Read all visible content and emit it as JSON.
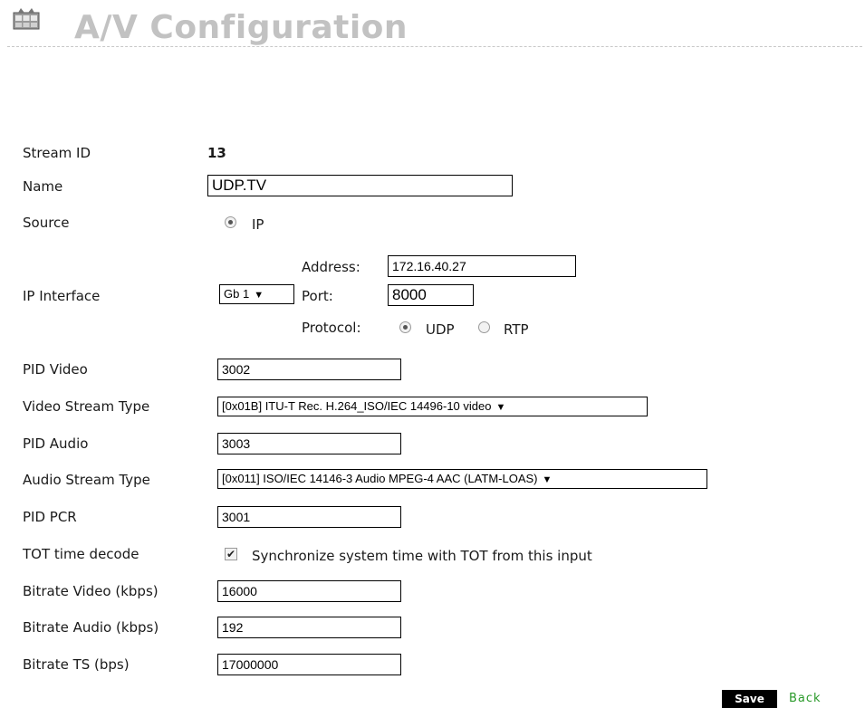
{
  "header": {
    "title": "A/V Configuration",
    "icon": "film-strip-icon"
  },
  "fields": {
    "stream_id": {
      "label": "Stream ID",
      "value": "13"
    },
    "name": {
      "label": "Name",
      "value": "UDP.TV"
    },
    "source": {
      "label": "Source",
      "option": "IP",
      "selected": true
    },
    "ip_interface": {
      "label": "IP Interface",
      "interface_value": "Gb 1",
      "address_label": "Address:",
      "address_value": "172.16.40.27",
      "port_label": "Port:",
      "port_value": "8000",
      "protocol_label": "Protocol:",
      "protocol_options": [
        "UDP",
        "RTP"
      ],
      "protocol_selected": "UDP"
    },
    "pid_video": {
      "label": "PID Video",
      "value": "3002"
    },
    "video_stream_type": {
      "label": "Video Stream Type",
      "value": "[0x01B] ITU-T Rec. H.264_ISO/IEC 14496-10 video"
    },
    "pid_audio": {
      "label": "PID Audio",
      "value": "3003"
    },
    "audio_stream_type": {
      "label": "Audio Stream Type",
      "value": "[0x011] ISO/IEC 14146-3 Audio MPEG-4 AAC (LATM-LOAS)"
    },
    "pid_pcr": {
      "label": "PID PCR",
      "value": "3001"
    },
    "tot_time_decode": {
      "label": "TOT time decode",
      "checkbox_label": "Synchronize system time with TOT from this input",
      "checked": true
    },
    "bitrate_video": {
      "label": "Bitrate Video (kbps)",
      "value": "16000"
    },
    "bitrate_audio": {
      "label": "Bitrate Audio (kbps)",
      "value": "192"
    },
    "bitrate_ts": {
      "label": "Bitrate TS (bps)",
      "value": "17000000"
    }
  },
  "actions": {
    "save_label": "Save",
    "back_label": "Back"
  },
  "colors": {
    "title": "#c2c2c2",
    "back_link": "#2a9a2a",
    "save_bg": "#000000"
  }
}
